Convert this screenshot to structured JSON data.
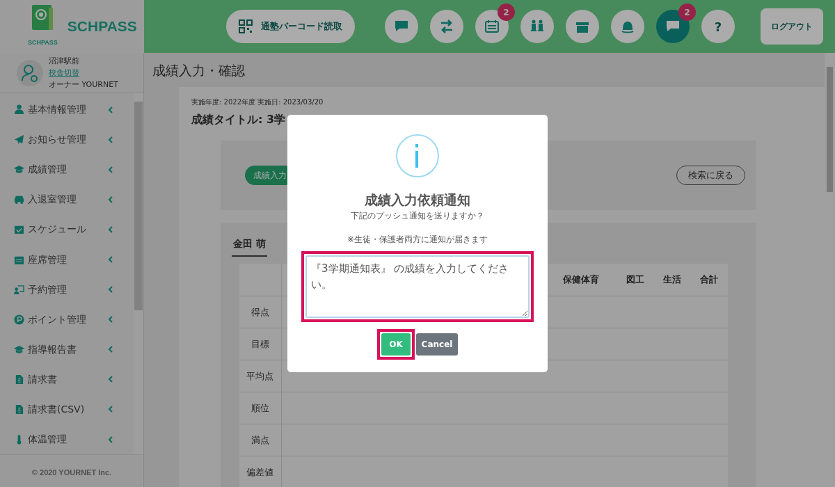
{
  "brand": {
    "logo_caption": "SCHPASS",
    "name": "SCHPASS"
  },
  "header": {
    "barcode_button": "通塾バーコード読取",
    "icon_buttons": [
      {
        "kind": "chat",
        "selected": false
      },
      {
        "kind": "swap",
        "selected": false
      },
      {
        "kind": "calendar",
        "selected": false,
        "badge": "2"
      },
      {
        "kind": "seats",
        "selected": false
      },
      {
        "kind": "gift",
        "selected": false
      },
      {
        "kind": "bell",
        "selected": false
      },
      {
        "kind": "chat",
        "selected": true,
        "badge": "2"
      },
      {
        "kind": "text",
        "selected": false,
        "label": "?"
      }
    ],
    "logout": "ログアウト"
  },
  "user": {
    "school": "沼津駅前",
    "switch_link": "校舎切替",
    "role": "オーナー YOURNET"
  },
  "sidebar": {
    "items": [
      {
        "label": "基本情報管理"
      },
      {
        "label": "お知らせ管理"
      },
      {
        "label": "成績管理"
      },
      {
        "label": "入退室管理"
      },
      {
        "label": "スケジュール"
      },
      {
        "label": "座席管理"
      },
      {
        "label": "予約管理"
      },
      {
        "label": "ポイント管理"
      },
      {
        "label": "指導報告書"
      },
      {
        "label": "請求書"
      },
      {
        "label": "請求書(CSV)"
      },
      {
        "label": "体温管理"
      }
    ],
    "footer": "© 2020 YOURNET Inc."
  },
  "page": {
    "title": "成績入力・確認",
    "meta": "実施年度: 2022年度 実施日: 2023/03/20",
    "grade_title_label": "成績タイトル:",
    "grade_title_link": "3学",
    "input_pill": "成績入力",
    "back_button": "検索に戻る",
    "student_tab": "金田 萌"
  },
  "table": {
    "columns": [
      "保健体育",
      "図工",
      "生活",
      "合計"
    ],
    "row_labels": [
      "得点",
      "目標",
      "平均点",
      "順位",
      "満点",
      "偏差値"
    ]
  },
  "modal": {
    "title": "成績入力依頼通知",
    "question": "下記のプッシュ通知を送りますか？",
    "note": "※生徒・保護者両方に通知が届きます",
    "message": "『3学期通知表』 の成績を入力してください。",
    "ok": "OK",
    "cancel": "Cancel"
  }
}
